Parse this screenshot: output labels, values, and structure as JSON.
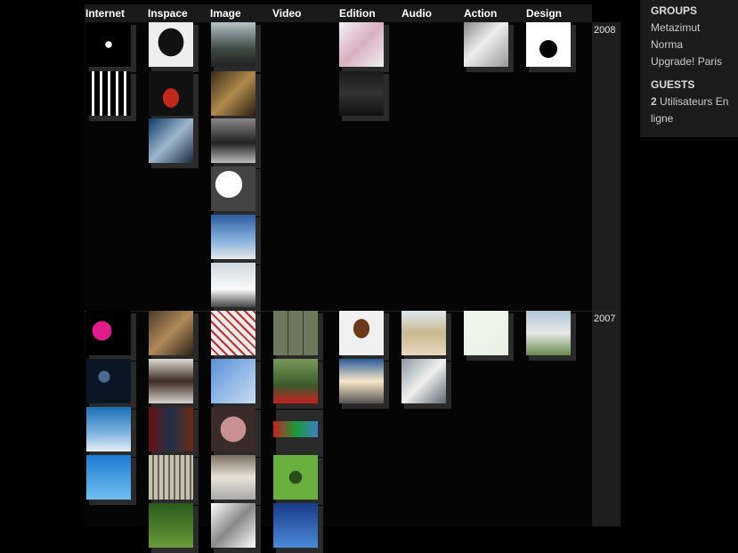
{
  "columns": [
    "Internet",
    "Inspace",
    "Image",
    "Video",
    "Edition",
    "Audio",
    "Action",
    "Design"
  ],
  "years": [
    "2008",
    "2007"
  ],
  "sidebar": {
    "groups_title": "GROUPS",
    "groups": [
      "Metazimut",
      "Norma",
      "Upgrade! Paris"
    ],
    "guests_title": "GUESTS",
    "guests_count": "2",
    "guests_label": "Utilisateurs En ligne"
  },
  "thumb_names": {
    "s2008c1": [
      "oz-logo-thumbnail",
      "barcode-bars-thumbnail"
    ],
    "s2008c2": [
      "black-skull-thumbnail",
      "red-teeth-skull-thumbnail",
      "blue-structure-thumbnail"
    ],
    "s2008c3": [
      "sky-crowd-thumbnail",
      "ornate-interior-thumbnail",
      "greyscale-city-thumbnail",
      "smoke-plume-thumbnail",
      "blue-building-thumbnail",
      "snow-runner-thumbnail"
    ],
    "s2008c5": [
      "red-network-thumbnail",
      "cities-text-thumbnail"
    ],
    "s2008c7": [
      "white-cube-thumbnail"
    ],
    "s2008c8": [
      "alesa-poster-thumbnail"
    ],
    "s2007c1": [
      "pink-figures-thumbnail",
      "dark-particles-thumbnail",
      "generateur-poster-thumbnail",
      "blue-water-thumbnail"
    ],
    "s2007c2": [
      "bronze-sculpture-thumbnail",
      "framed-painting-thumbnail",
      "neon-room-thumbnail",
      "curved-roof-thumbnail",
      "green-wall-thumbnail"
    ],
    "s2007c3": [
      "braided-rope-thumbnail",
      "blurry-blue-thumbnail",
      "lips-closeup-thumbnail",
      "white-dome-thumbnail",
      "sketch-drawing-thumbnail"
    ],
    "s2007c4": [
      "photo-grid-thumbnail",
      "poppy-field-thumbnail",
      "color-strips-thumbnail",
      "alien-face-thumbnail",
      "blue-face-thumbnail"
    ],
    "s2007c5": [
      "hanging-figure-thumbnail",
      "light-beam-thumbnail"
    ],
    "s2007c6": [
      "fake-off-letters-thumbnail",
      "turntable-thumbnail"
    ],
    "s2007c7": [
      "wire-drawing-thumbnail"
    ],
    "s2007c8": [
      "white-architecture-thumbnail"
    ]
  },
  "colors": {
    "background": "#000000",
    "year_column": "#1e1e1e",
    "panel": "#1b1b1b"
  }
}
